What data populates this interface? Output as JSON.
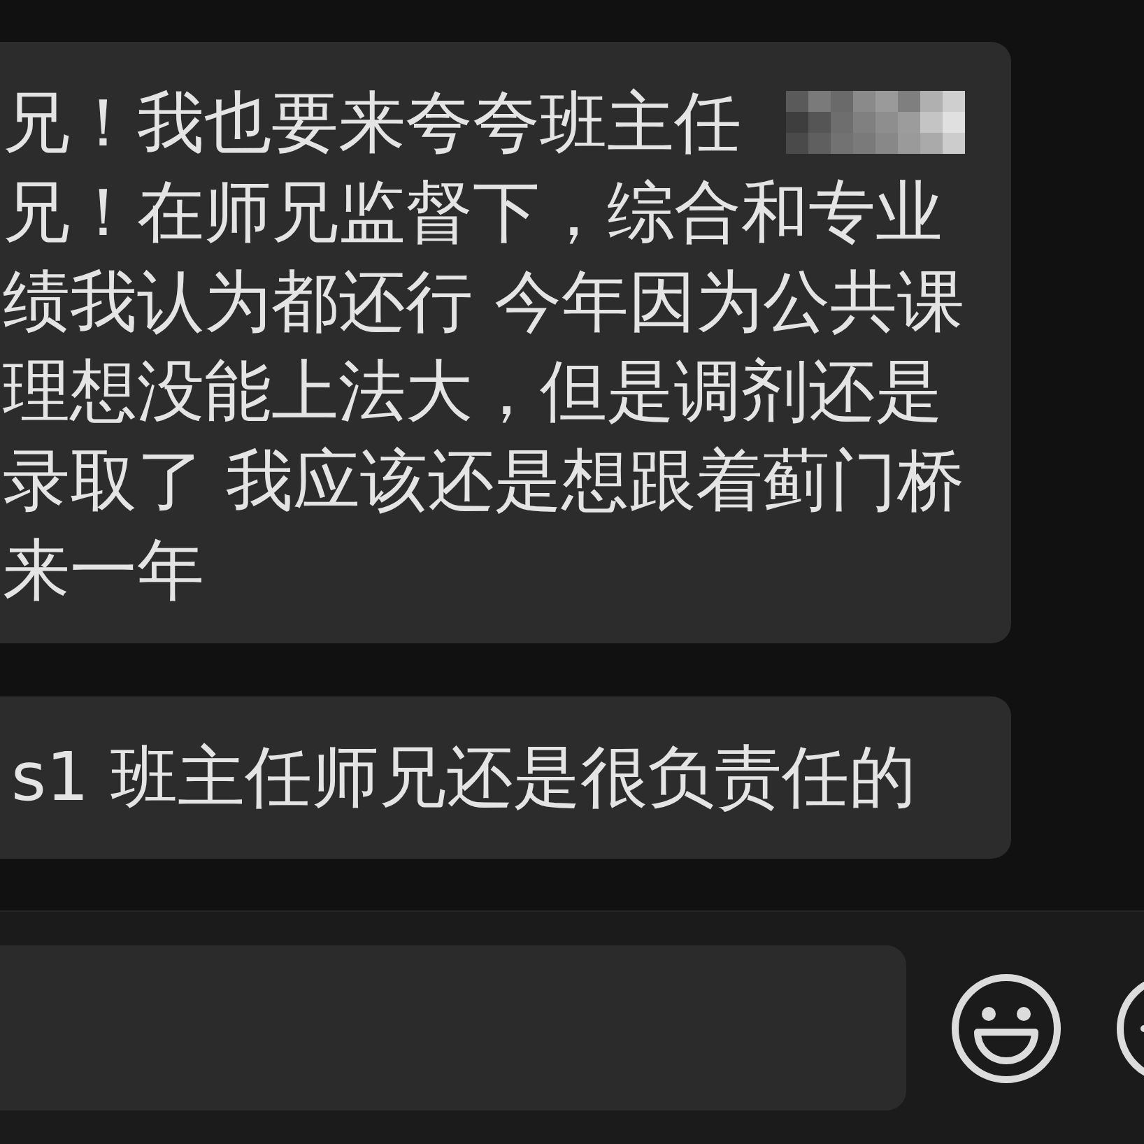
{
  "messages": [
    {
      "lines": [
        "兄！我也要来夸夸班主任",
        "兄！在师兄监督下，综合和专业",
        "绩我认为都还行 今年因为公共课",
        "理想没能上法大，但是调剂还是",
        "录取了 我应该还是想跟着蓟门桥",
        "来一年"
      ],
      "redacted": true
    },
    {
      "lines": [
        "s1 班主任师兄还是很负责任的"
      ],
      "redacted": false
    }
  ]
}
